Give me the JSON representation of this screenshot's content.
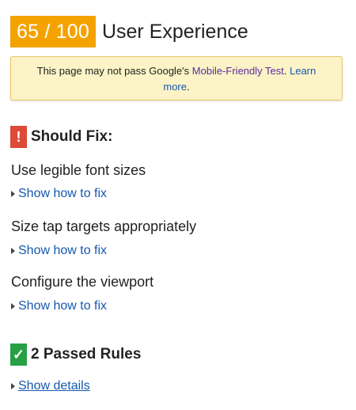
{
  "header": {
    "score": "65 / 100",
    "title": "User Experience"
  },
  "notice": {
    "text_before": "This page may not pass Google's ",
    "link_mobile": "Mobile-Friendly Test",
    "text_mid": ". ",
    "link_learn": "Learn more",
    "text_after": "."
  },
  "should_fix": {
    "icon": "!",
    "title": "Should Fix:",
    "rules": [
      {
        "label": "Use legible font sizes",
        "link": "Show how to fix"
      },
      {
        "label": "Size tap targets appropriately",
        "link": "Show how to fix"
      },
      {
        "label": "Configure the viewport",
        "link": "Show how to fix"
      }
    ]
  },
  "passed": {
    "icon": "✓",
    "title": "2 Passed Rules",
    "link": "Show details"
  },
  "colors": {
    "score_badge": "#f4a200",
    "warn_icon": "#dc4a38",
    "ok_icon": "#27a045",
    "link": "#1558b0",
    "notice_bg": "#fcf3c6"
  }
}
